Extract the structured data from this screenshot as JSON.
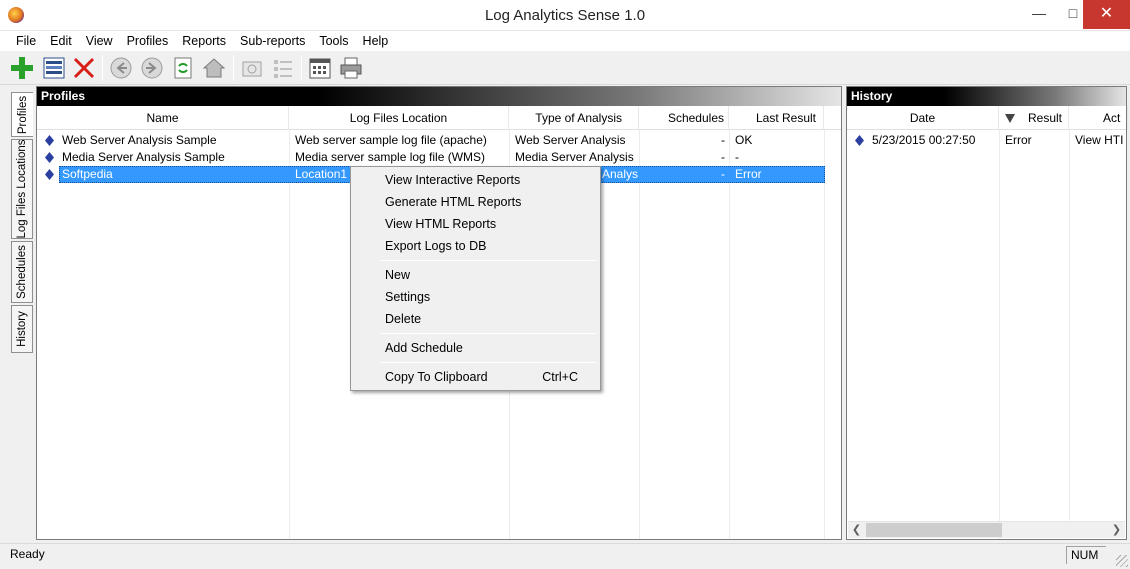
{
  "window": {
    "title": "Log Analytics Sense 1.0"
  },
  "menu": [
    "File",
    "Edit",
    "View",
    "Profiles",
    "Reports",
    "Sub-reports",
    "Tools",
    "Help"
  ],
  "toolbar": [
    {
      "name": "add-icon"
    },
    {
      "name": "list-icon"
    },
    {
      "name": "delete-icon"
    },
    {
      "name": "back-icon"
    },
    {
      "name": "forward-icon"
    },
    {
      "name": "refresh-icon"
    },
    {
      "name": "home-icon"
    },
    {
      "name": "camera-icon"
    },
    {
      "name": "checklist-icon"
    },
    {
      "name": "calendar-icon"
    },
    {
      "name": "print-icon"
    }
  ],
  "side_tabs": [
    "Profiles",
    "Log Files Locations",
    "Schedules",
    "History"
  ],
  "profiles": {
    "title": "Profiles",
    "columns": [
      "Name",
      "Log Files Location",
      "Type of Analysis",
      "Schedules",
      "Last Result"
    ],
    "rows": [
      {
        "name": "Web Server Analysis Sample",
        "location": "Web server sample log file (apache)",
        "type": "Web Server Analysis",
        "schedules": "-",
        "result": "OK"
      },
      {
        "name": "Media Server Analysis Sample",
        "location": "Media server sample log file (WMS)",
        "type": "Media Server Analysis",
        "schedules": "-",
        "result": "-"
      },
      {
        "name": "Softpedia",
        "location": "Location1",
        "type": "Analysis",
        "schedules": "-",
        "result": "Error"
      }
    ]
  },
  "history": {
    "title": "History",
    "columns": [
      "Date",
      "Result",
      "Act"
    ],
    "rows": [
      {
        "date": "5/23/2015 00:27:50",
        "result": "Error",
        "action": "View HTI"
      }
    ]
  },
  "context_menu": {
    "items": [
      "View Interactive Reports",
      "Generate HTML Reports",
      "View HTML Reports",
      "Export Logs to DB",
      "New",
      "Settings",
      "Delete",
      "Add Schedule",
      "Copy To Clipboard"
    ],
    "shortcut": "Ctrl+C"
  },
  "status": {
    "text": "Ready",
    "num": "NUM"
  },
  "colors": {
    "selection": "#3399ff",
    "close_button": "#c7372f"
  }
}
